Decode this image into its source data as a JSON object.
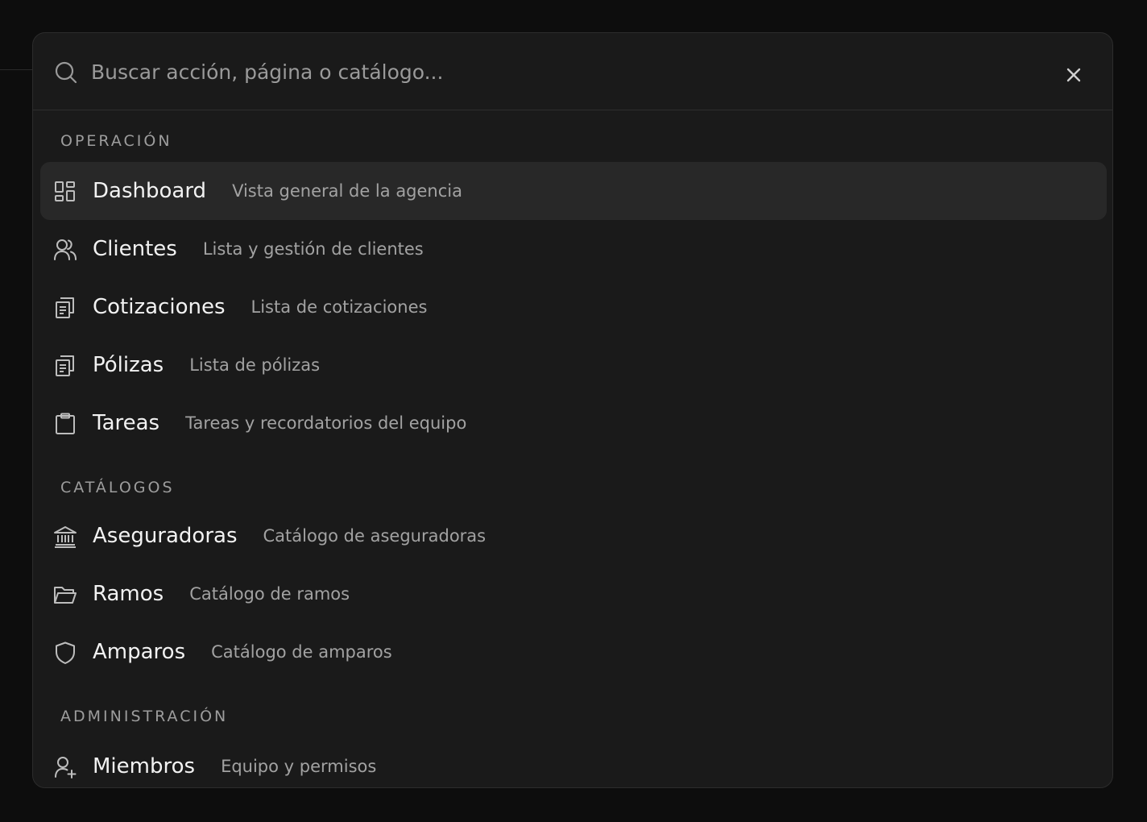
{
  "search": {
    "placeholder": "Buscar acción, página o catálogo...",
    "value": ""
  },
  "icons": {
    "search": "search-icon",
    "close": "close-icon"
  },
  "colors": {
    "background": "#0d0d0d",
    "panel": "#1a1a1a",
    "active_row": "#282828",
    "label": "#f2f2f2",
    "description": "#a2a2a2",
    "heading": "#9d9d9d"
  },
  "groups": [
    {
      "heading": "OPERACIÓN",
      "items": [
        {
          "label": "Dashboard",
          "description": "Vista general de la agencia",
          "icon": "dashboard-icon",
          "active": true
        },
        {
          "label": "Clientes",
          "description": "Lista y gestión de clientes",
          "icon": "users-icon"
        },
        {
          "label": "Cotizaciones",
          "description": "Lista de cotizaciones",
          "icon": "documents-icon"
        },
        {
          "label": "Pólizas",
          "description": "Lista de pólizas",
          "icon": "documents-icon"
        },
        {
          "label": "Tareas",
          "description": "Tareas y recordatorios del equipo",
          "icon": "clipboard-icon"
        }
      ]
    },
    {
      "heading": "CATÁLOGOS",
      "items": [
        {
          "label": "Aseguradoras",
          "description": "Catálogo de aseguradoras",
          "icon": "bank-icon"
        },
        {
          "label": "Ramos",
          "description": "Catálogo de ramos",
          "icon": "folder-icon"
        },
        {
          "label": "Amparos",
          "description": "Catálogo de amparos",
          "icon": "shield-icon"
        }
      ]
    },
    {
      "heading": "ADMINISTRACIÓN",
      "items": [
        {
          "label": "Miembros",
          "description": "Equipo y permisos",
          "icon": "user-plus-icon"
        }
      ]
    }
  ]
}
